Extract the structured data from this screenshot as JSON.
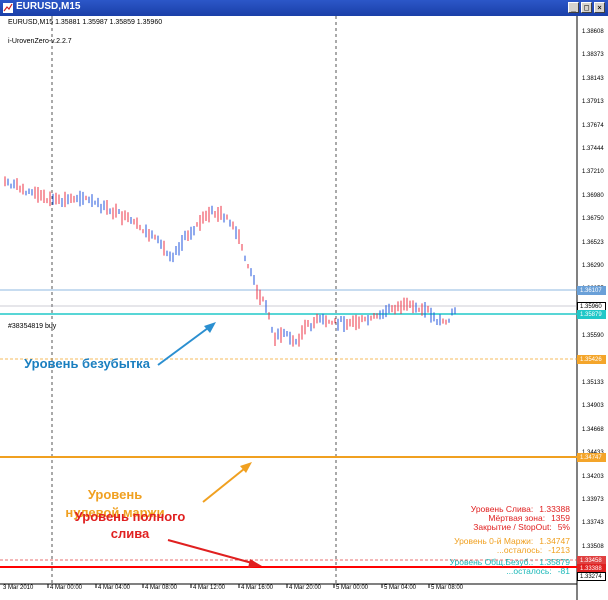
{
  "window": {
    "title": "EURUSD,M15",
    "buttons": [
      "_",
      "□",
      "×"
    ]
  },
  "chart_info": {
    "header": "EURUSD,M15  1.35881 1.35987 1.35859 1.35960",
    "indicator": "i-UrovenZero-v.2.2.7"
  },
  "price_axis": [
    "1.38608",
    "1.38373",
    "1.38143",
    "1.37913",
    "1.37674",
    "1.37444",
    "1.37210",
    "1.36980",
    "1.36750",
    "1.36523",
    "1.36290",
    "1.36055",
    "1.35825",
    "1.35590",
    "1.35360",
    "1.35133",
    "1.34903",
    "1.34668",
    "1.34433",
    "1.34203",
    "1.33973",
    "1.33743",
    "1.33508"
  ],
  "price_tags": [
    {
      "label": "1.36107",
      "color": "#6aa0d8",
      "text_color": "#ffffff"
    },
    {
      "label": "1.35960",
      "color": "#ffffff",
      "text_color": "#000000"
    },
    {
      "label": "1.35879",
      "color": "#21c8c8",
      "text_color": "#ffffff"
    },
    {
      "label": "1.35426",
      "color": "#f4a52a",
      "text_color": "#ffffff"
    },
    {
      "label": "1.34747",
      "color": "#f4a52a",
      "text_color": "#ffffff"
    },
    {
      "label": "1.33458",
      "color": "#e04040",
      "text_color": "#ffffff"
    },
    {
      "label": "1.33388",
      "color": "#e02020",
      "text_color": "#ffffff"
    },
    {
      "label": "1.33274",
      "color": "#ffffff",
      "text_color": "#000000"
    }
  ],
  "time_axis": [
    "3 Mar 2010",
    "4 Mar 00:00",
    "4 Mar 04:00",
    "4 Mar 08:00",
    "4 Mar 12:00",
    "4 Mar 16:00",
    "4 Mar 20:00",
    "5 Mar 00:00",
    "5 Mar 04:00",
    "5 Mar 08:00"
  ],
  "position_label": "#38354819 buy",
  "annotations": {
    "breakeven": "Уровень безубытка",
    "zero_margin": "Уровень нулевой маржи",
    "full_loss": "Уровень полного слива"
  },
  "stats": {
    "loss_level_label": "Уровень Слива:",
    "loss_level_value": "1.33388",
    "dead_zone_label": "Мёртвая зона:",
    "dead_zone_value": "1359",
    "close_stopout_label": "Закрытие / StopOut:",
    "close_stopout_value": "5%",
    "zero_margin_label": "Уровень 0-й Маржи:",
    "zero_margin_value": "1.34747",
    "zero_margin_left_label": "...осталось:",
    "zero_margin_left_value": "-1213",
    "breakeven_label": "Уровень Общ.Безуб.:",
    "breakeven_value": "1.35879",
    "breakeven_left_label": "...осталось:",
    "breakeven_left_value": "-81"
  },
  "colors": {
    "bull": "#2255dd",
    "bear": "#ee3344",
    "breakeven": "#21c8c8",
    "zero_margin": "#f0a020",
    "full_loss": "#ff0000",
    "loss_text": "#e02020",
    "zero_text": "#f0a020",
    "breakeven_text": "#1ab8b8",
    "breakeven_arrow": "#2b8fd0"
  }
}
